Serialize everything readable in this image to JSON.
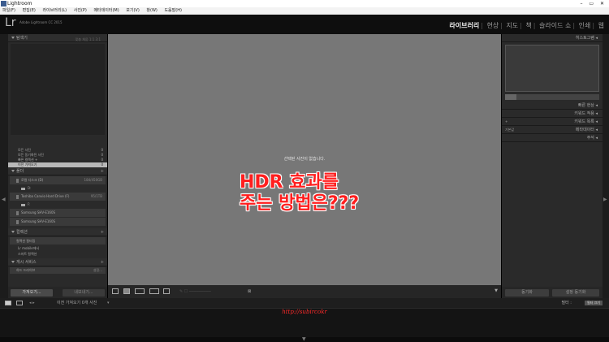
{
  "window": {
    "title": "Lightroom",
    "controls": "– ▭ ✕"
  },
  "menubar": [
    "파일(F)",
    "편집(E)",
    "라이브러리(L)",
    "사진(P)",
    "메타데이터(M)",
    "보기(V)",
    "창(W)",
    "도움말(H)"
  ],
  "identity": {
    "logo": "Lr",
    "version": "Adobe Lightroom CC 2015",
    "modules": [
      "라이브러리",
      "현상",
      "지도",
      "책",
      "슬라이드 쇼",
      "인쇄",
      "웹"
    ],
    "active_module": "라이브러리"
  },
  "left_panel": {
    "navigator": {
      "title": "탐색기",
      "zoom": "맞춤  채움  1:1  3:1"
    },
    "catalog": [
      {
        "label": "모든 사진",
        "count": "0"
      },
      {
        "label": "모든 동기화된 사진",
        "count": "0"
      },
      {
        "label": "빠른 컬렉션 +",
        "count": "0"
      },
      {
        "label": "이전 가져오기",
        "count": "0"
      }
    ],
    "folders": {
      "title": "폴더",
      "drives": [
        {
          "name": "로컬 디스크 (D)",
          "meta": "184/450GB",
          "sub": "D:"
        },
        {
          "name": "Toshiba Canvio Hard Drive (F)",
          "meta": "95/1TB",
          "sub": "F:"
        },
        {
          "name": "Samsung SHV-E160S",
          "meta": ""
        },
        {
          "name": "Samsung SHV-E160S",
          "meta": ""
        }
      ]
    },
    "collections": {
      "title": "컬렉션",
      "filter": "컬렉션 필터링",
      "items": [
        "Lr mobile에서",
        "스마트 컬렉션"
      ]
    },
    "publish": {
      "title": "게시 서비스",
      "item": "하드 드라이브",
      "setup": "설정..."
    },
    "buttons": {
      "import": "가져오기...",
      "export": "내보내기..."
    }
  },
  "grid": {
    "empty_message": "선택된 사진이 없습니다.",
    "overlay_line1": "HDR 효과를",
    "overlay_line2": "주는 방법은???"
  },
  "right_panel": {
    "histogram": "히스토그램",
    "sections": [
      "빠른 현상",
      "키워드 적용",
      "키워드 목록",
      "메타데이터",
      "주석"
    ],
    "preset_tag": "기본값",
    "buttons": {
      "sync": "동기화",
      "sync_settings": "설정 동기화"
    }
  },
  "filmstrip": {
    "source": "이전 가져오기  0개 사진",
    "filter_label": "필터 :",
    "filter_value": "필터 끄기",
    "watermark": "http://subircokr"
  }
}
